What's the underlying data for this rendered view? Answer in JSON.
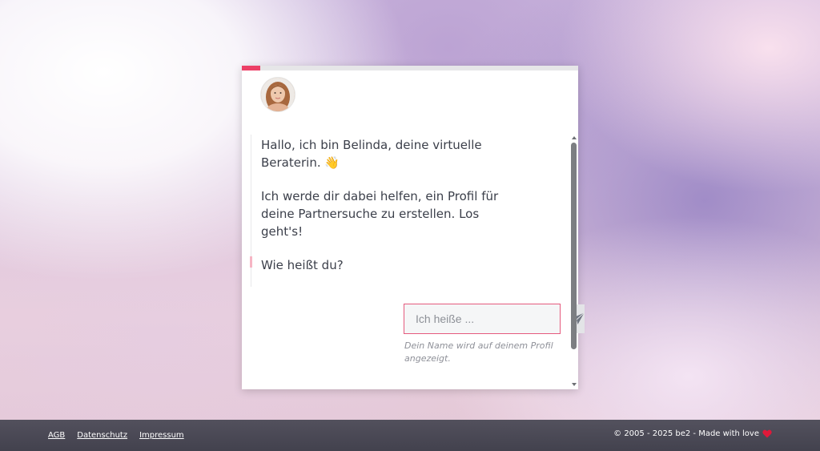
{
  "progress": {
    "value": 0.055,
    "color": "#ec3f66"
  },
  "chat": {
    "avatar_icon": "assistant-avatar-icon",
    "message": [
      "Hallo, ich bin Belinda, deine virtuelle Beraterin. 👋",
      "Ich werde dir dabei helfen, ein Profil für deine Partnersuche zu erstellen. Los geht's!",
      "Wie heißt du?"
    ],
    "input": {
      "value": "",
      "placeholder": "Ich heiße ...",
      "border_color": "#e55a7e"
    },
    "send_icon": "send-paper-plane-icon",
    "hint": "Dein Name wird auf deinem Profil angezeigt."
  },
  "footer": {
    "links": [
      "AGB",
      "Datenschutz",
      "Impressum"
    ],
    "copyright": "© 2005 - 2025 be2 - Made with love",
    "heart_icon": "heart-icon",
    "heart_color": "#e0193a"
  }
}
